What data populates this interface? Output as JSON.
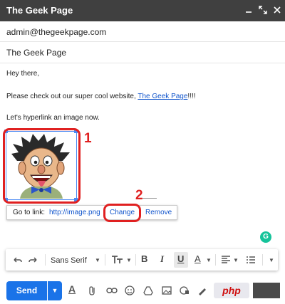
{
  "window": {
    "title": "The Geek Page",
    "controls": [
      "minimize-icon",
      "expand-icon",
      "close-icon"
    ]
  },
  "compose": {
    "to": "admin@thegeekpage.com",
    "subject": "The Geek Page",
    "greeting": "Hey there,",
    "line1_prefix": "Please check out our super cool website, ",
    "line1_link": "The Geek Page",
    "line1_suffix": "!!!!",
    "line2": "Let's hyperlink an image now."
  },
  "link_popup": {
    "goto_label": "Go to link:",
    "url": "http://image.png",
    "change": "Change",
    "remove": "Remove"
  },
  "annotations": {
    "step1": "1",
    "step2": "2"
  },
  "grammarly": {
    "label": "G"
  },
  "toolbar": {
    "font": "Sans Serif",
    "bold": "B",
    "italic": "I",
    "underline": "U",
    "text_color": "A"
  },
  "bottom": {
    "send": "Send"
  },
  "watermark": {
    "text": "php"
  },
  "colors": {
    "accent": "#1a73e8",
    "annotation": "#e02020",
    "titlebar": "#404040"
  }
}
